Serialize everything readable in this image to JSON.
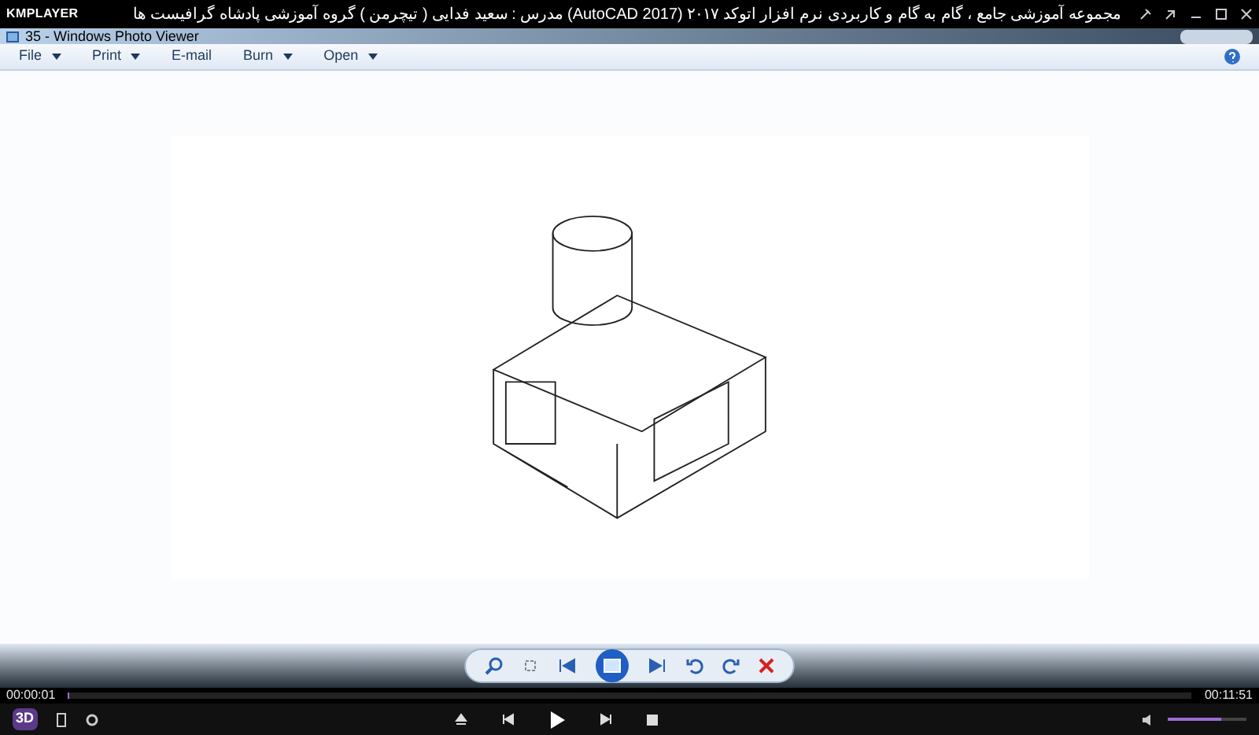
{
  "player": {
    "logo": "KMPLAYER",
    "title": "مجموعه آموزشی جامع ، گام به گام و کاربردی نرم افزار  اتوکد ۲۰۱۷ (AutoCAD 2017)  مدرس : سعید فدایی ( تیچرمن ) گروه آموزشی پادشاه گرافیست ها",
    "badge": "3D"
  },
  "viewer": {
    "title": "35 - Windows Photo Viewer",
    "menu": [
      {
        "label": "File",
        "dropdown": true
      },
      {
        "label": "Print",
        "dropdown": true
      },
      {
        "label": "E-mail",
        "dropdown": false
      },
      {
        "label": "Burn",
        "dropdown": true
      },
      {
        "label": "Open",
        "dropdown": true
      }
    ]
  },
  "playback": {
    "elapsed": "00:00:01",
    "total": "00:11:51",
    "level": 0.0014,
    "volume": {
      "level": 0.68
    }
  }
}
